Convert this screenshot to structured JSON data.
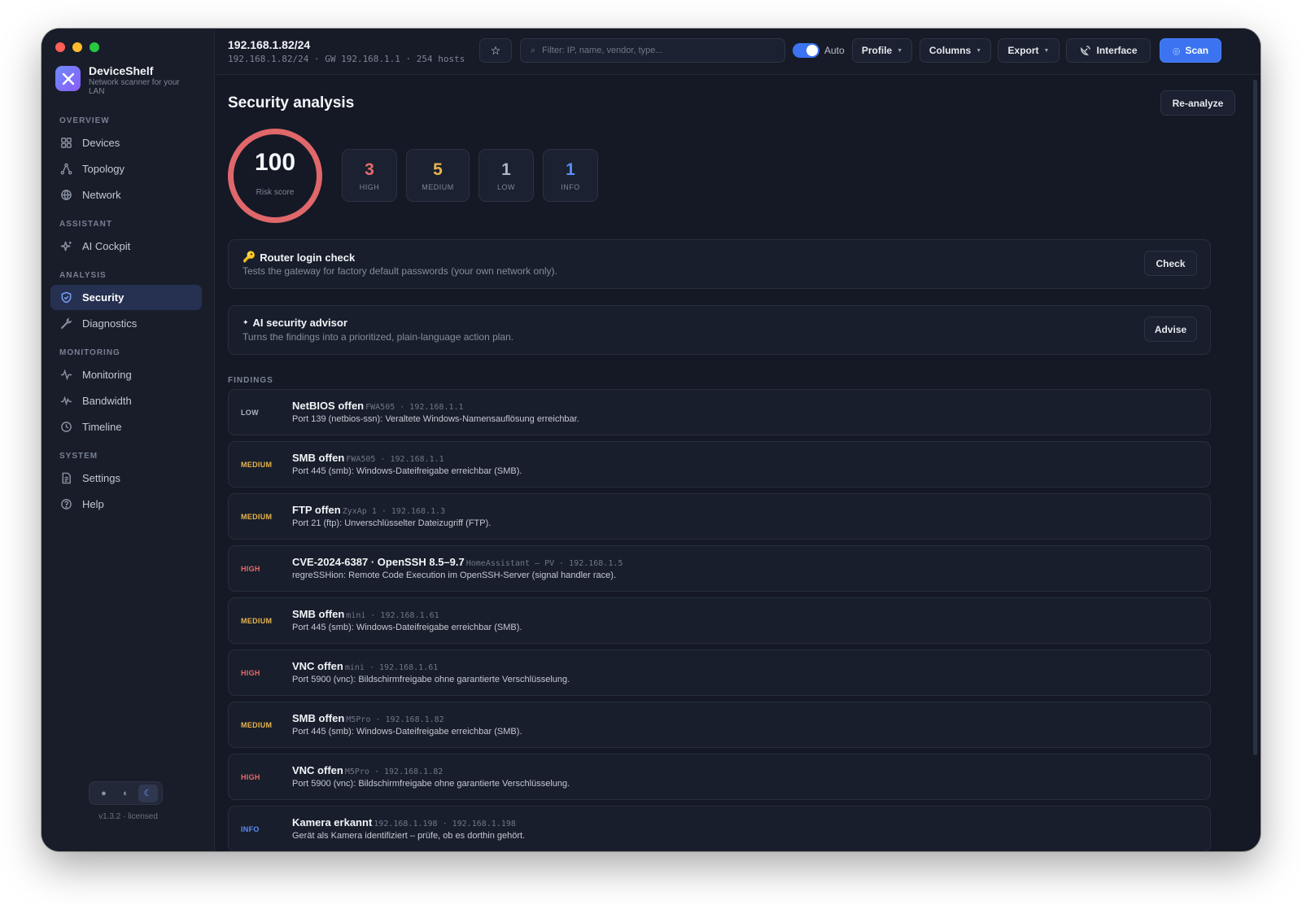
{
  "app": {
    "name": "DeviceShelf",
    "tagline": "Network scanner for your LAN",
    "version": "v1.3.2 · licensed"
  },
  "sidebar": {
    "sections": {
      "overview": "OVERVIEW",
      "assistant": "ASSISTANT",
      "analysis": "ANALYSIS",
      "monitoring": "MONITORING",
      "system": "SYSTEM"
    },
    "items": {
      "devices": "Devices",
      "topology": "Topology",
      "network": "Network",
      "ai_cockpit": "AI Cockpit",
      "security": "Security",
      "diagnostics": "Diagnostics",
      "monitoring": "Monitoring",
      "bandwidth": "Bandwidth",
      "timeline": "Timeline",
      "settings": "Settings",
      "help": "Help"
    },
    "active_item": "security",
    "theme_options": [
      "light",
      "system",
      "dark"
    ],
    "theme_selected": "dark"
  },
  "toolbar": {
    "title": "192.168.1.82/24",
    "subtitle": "192.168.1.82/24 · GW 192.168.1.1 · 254 hosts",
    "search_placeholder": "Filter: IP, name, vendor, type...",
    "auto_label": "Auto",
    "auto_enabled": true,
    "profile_label": "Profile",
    "columns_label": "Columns",
    "export_label": "Export",
    "interface_label": "Interface",
    "scan_label": "Scan"
  },
  "security": {
    "title": "Security analysis",
    "reanalyze_label": "Re-analyze",
    "risk_score": "100",
    "risk_label": "Risk score",
    "counts": {
      "high": {
        "value": "3",
        "label": "HIGH"
      },
      "medium": {
        "value": "5",
        "label": "MEDIUM"
      },
      "low": {
        "value": "1",
        "label": "LOW"
      },
      "info": {
        "value": "1",
        "label": "INFO"
      }
    },
    "router_check": {
      "title": "Router login check",
      "desc": "Tests the gateway for factory default passwords (your own network only).",
      "button": "Check"
    },
    "ai_advisor": {
      "title": "AI security advisor",
      "desc": "Turns the findings into a prioritized, plain-language action plan.",
      "button": "Advise"
    },
    "findings_label": "FINDINGS",
    "findings": [
      {
        "severity": "LOW",
        "title": "NetBIOS offen",
        "meta": "FWA505 · 192.168.1.1",
        "desc": "Port 139 (netbios-ssn): Veraltete Windows-Namensauflösung erreichbar."
      },
      {
        "severity": "MEDIUM",
        "title": "SMB offen",
        "meta": "FWA505 · 192.168.1.1",
        "desc": "Port 445 (smb): Windows-Dateifreigabe erreichbar (SMB)."
      },
      {
        "severity": "MEDIUM",
        "title": "FTP offen",
        "meta": "ZyxAp 1 · 192.168.1.3",
        "desc": "Port 21 (ftp): Unverschlüsselter Dateizugriff (FTP)."
      },
      {
        "severity": "HIGH",
        "title": "CVE-2024-6387 · OpenSSH 8.5–9.7",
        "meta": "HomeAssistant – PV · 192.168.1.5",
        "desc": "regreSSHion: Remote Code Execution im OpenSSH-Server (signal handler race)."
      },
      {
        "severity": "MEDIUM",
        "title": "SMB offen",
        "meta": "mini · 192.168.1.61",
        "desc": "Port 445 (smb): Windows-Dateifreigabe erreichbar (SMB)."
      },
      {
        "severity": "HIGH",
        "title": "VNC offen",
        "meta": "mini · 192.168.1.61",
        "desc": "Port 5900 (vnc): Bildschirmfreigabe ohne garantierte Verschlüsselung."
      },
      {
        "severity": "MEDIUM",
        "title": "SMB offen",
        "meta": "M5Pro · 192.168.1.82",
        "desc": "Port 445 (smb): Windows-Dateifreigabe erreichbar (SMB)."
      },
      {
        "severity": "HIGH",
        "title": "VNC offen",
        "meta": "M5Pro · 192.168.1.82",
        "desc": "Port 5900 (vnc): Bildschirmfreigabe ohne garantierte Verschlüsselung."
      },
      {
        "severity": "INFO",
        "title": "Kamera erkannt",
        "meta": "192.168.1.198 · 192.168.1.198",
        "desc": "Gerät als Kamera identifiziert – prüfe, ob es dorthin gehört."
      }
    ]
  },
  "colors": {
    "high": "#e96a6c",
    "medium": "#e8b44d",
    "low": "#aeb4c0",
    "info": "#5b8cf6",
    "accent": "#3b73f0"
  }
}
